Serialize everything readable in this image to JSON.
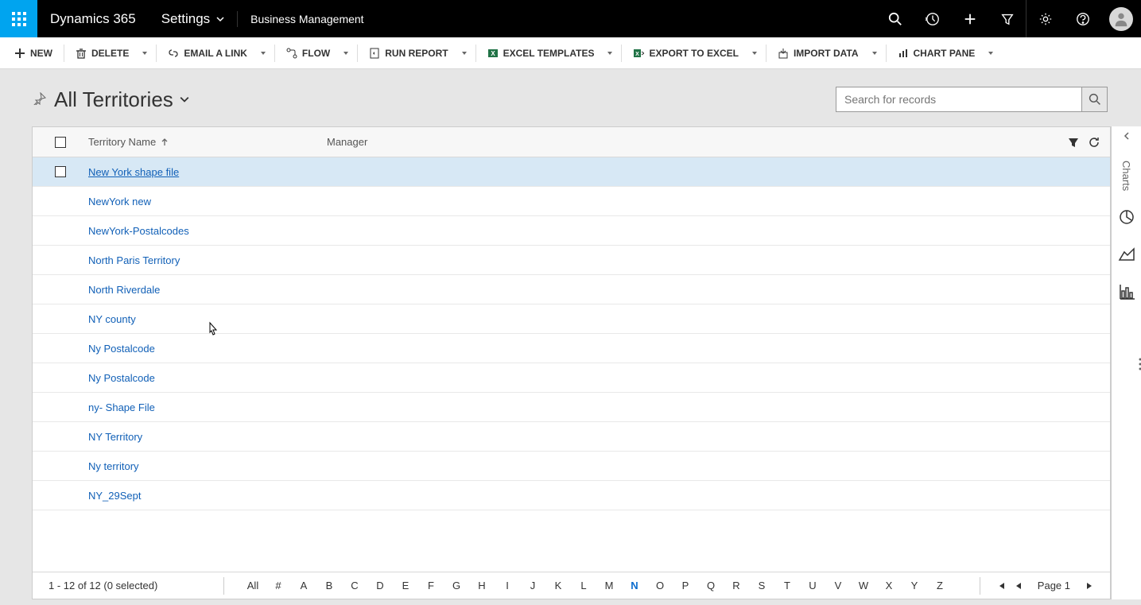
{
  "topbar": {
    "brand": "Dynamics 365",
    "nav_settings": "Settings",
    "nav_area": "Business Management"
  },
  "commandbar": {
    "new": "NEW",
    "delete": "DELETE",
    "email_link": "EMAIL A LINK",
    "flow": "FLOW",
    "run_report": "RUN REPORT",
    "excel_templates": "EXCEL TEMPLATES",
    "export_excel": "EXPORT TO EXCEL",
    "import_data": "IMPORT DATA",
    "chart_pane": "CHART PANE"
  },
  "view": {
    "title": "All Territories",
    "search_placeholder": "Search for records"
  },
  "grid": {
    "col_name": "Territory Name",
    "col_manager": "Manager",
    "rows": [
      {
        "name": "New York shape file",
        "manager": "",
        "hovered": true,
        "checkbox": true
      },
      {
        "name": "NewYork new",
        "manager": ""
      },
      {
        "name": "NewYork-Postalcodes",
        "manager": ""
      },
      {
        "name": "North Paris Territory",
        "manager": ""
      },
      {
        "name": "North Riverdale",
        "manager": ""
      },
      {
        "name": "NY county",
        "manager": ""
      },
      {
        "name": "Ny Postalcode",
        "manager": ""
      },
      {
        "name": "Ny Postalcode",
        "manager": ""
      },
      {
        "name": "ny- Shape File",
        "manager": ""
      },
      {
        "name": "NY Territory",
        "manager": ""
      },
      {
        "name": "Ny territory",
        "manager": ""
      },
      {
        "name": "NY_29Sept",
        "manager": ""
      }
    ]
  },
  "footer": {
    "status": "1 - 12 of 12 (0 selected)",
    "alpha": [
      "All",
      "#",
      "A",
      "B",
      "C",
      "D",
      "E",
      "F",
      "G",
      "H",
      "I",
      "J",
      "K",
      "L",
      "M",
      "N",
      "O",
      "P",
      "Q",
      "R",
      "S",
      "T",
      "U",
      "V",
      "W",
      "X",
      "Y",
      "Z"
    ],
    "active_alpha": "N",
    "page_label": "Page 1"
  },
  "chartrail": {
    "label": "Charts"
  }
}
